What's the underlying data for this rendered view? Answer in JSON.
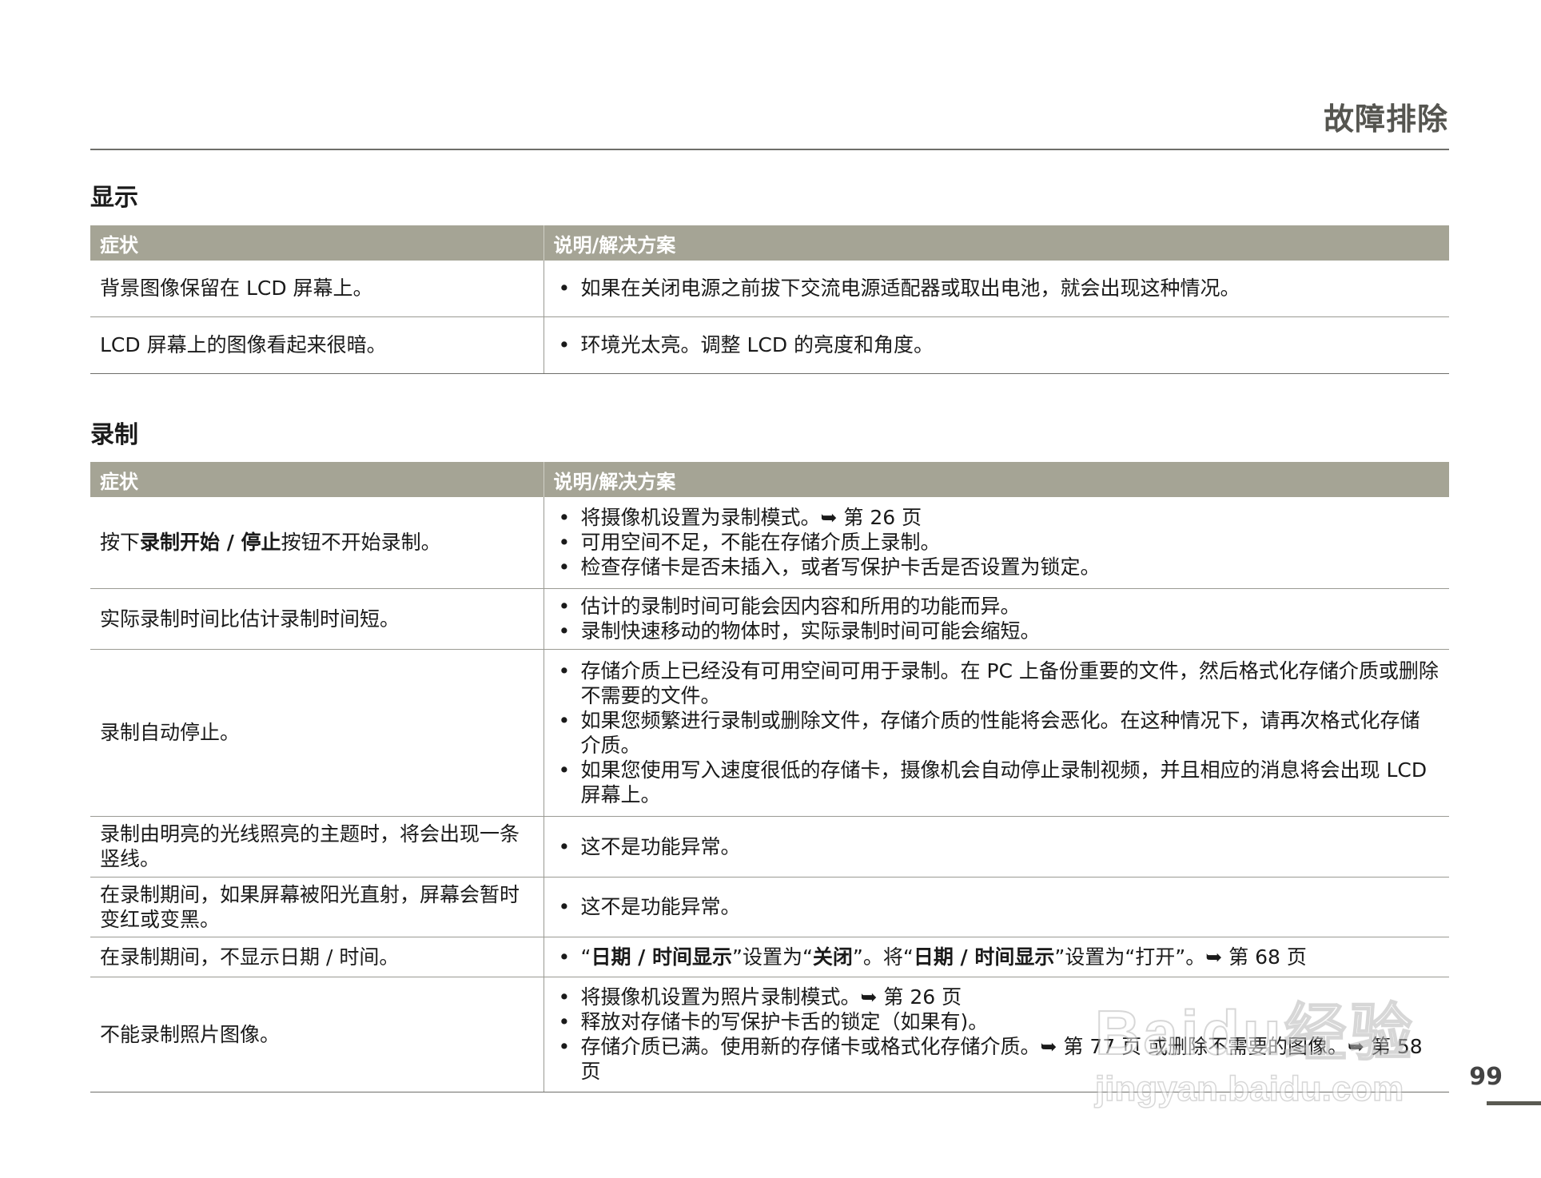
{
  "header": {
    "title": "故障排除"
  },
  "sections": [
    {
      "title": "显示",
      "col_symptom": "症状",
      "col_solution": "说明/解决方案",
      "rows": [
        {
          "symptom": "背景图像保留在 LCD 屏幕上。",
          "solutions": [
            "如果在关闭电源之前拔下交流电源适配器或取出电池，就会出现这种情况。"
          ]
        },
        {
          "symptom": "LCD 屏幕上的图像看起来很暗。",
          "solutions": [
            "环境光太亮。调整 LCD 的亮度和角度。"
          ]
        }
      ]
    },
    {
      "title": "录制",
      "col_symptom": "症状",
      "col_solution": "说明/解决方案",
      "rows": [
        {
          "symptom": {
            "pre": "按下",
            "bold": "录制开始 / 停止",
            "post": "按钮不开始录制。"
          },
          "solutions": [
            "将摄像机设置为录制模式。➥ 第 26 页",
            "可用空间不足，不能在存储介质上录制。",
            "检查存储卡是否未插入，或者写保护卡舌是否设置为锁定。"
          ]
        },
        {
          "symptom": "实际录制时间比估计录制时间短。",
          "solutions": [
            "估计的录制时间可能会因内容和所用的功能而异。",
            "录制快速移动的物体时，实际录制时间可能会缩短。"
          ]
        },
        {
          "symptom": "录制自动停止。",
          "solutions": [
            "存储介质上已经没有可用空间可用于录制。在 PC 上备份重要的文件，然后格式化存储介质或删除不需要的文件。",
            "如果您频繁进行录制或删除文件，存储介质的性能将会恶化。在这种情况下，请再次格式化存储介质。",
            "如果您使用写入速度很低的存储卡，摄像机会自动停止录制视频，并且相应的消息将会出现 LCD 屏幕上。"
          ]
        },
        {
          "symptom": "录制由明亮的光线照亮的主题时，将会出现一条竖线。",
          "solutions": [
            "这不是功能异常。"
          ]
        },
        {
          "symptom": "在录制期间，如果屏幕被阳光直射，屏幕会暂时变红或变黑。",
          "solutions": [
            "这不是功能异常。"
          ]
        },
        {
          "symptom": "在录制期间，不显示日期 / 时间。",
          "solution_rich": {
            "q1": "“",
            "b1": "日期 / 时间显示",
            "t1": "”设置为“",
            "b2": "关闭",
            "t2": "”。将“",
            "b3": "日期 / 时间显示",
            "t3": "”设置为“打开”。➥ 第 68 页"
          }
        },
        {
          "symptom": "不能录制照片图像。",
          "solutions": [
            "将摄像机设置为照片录制模式。➥ 第 26 页",
            "释放对存储卡的写保护卡舌的锁定（如果有)。",
            "存储介质已满。使用新的存储卡或格式化存储介质。➥ 第 77 页 或删除不需要的图像。➥ 第 58 页"
          ]
        }
      ]
    }
  ],
  "footer": {
    "page_number": "99"
  },
  "watermark": {
    "logo": "Baidu经验",
    "url": "jingyan.baidu.com"
  }
}
